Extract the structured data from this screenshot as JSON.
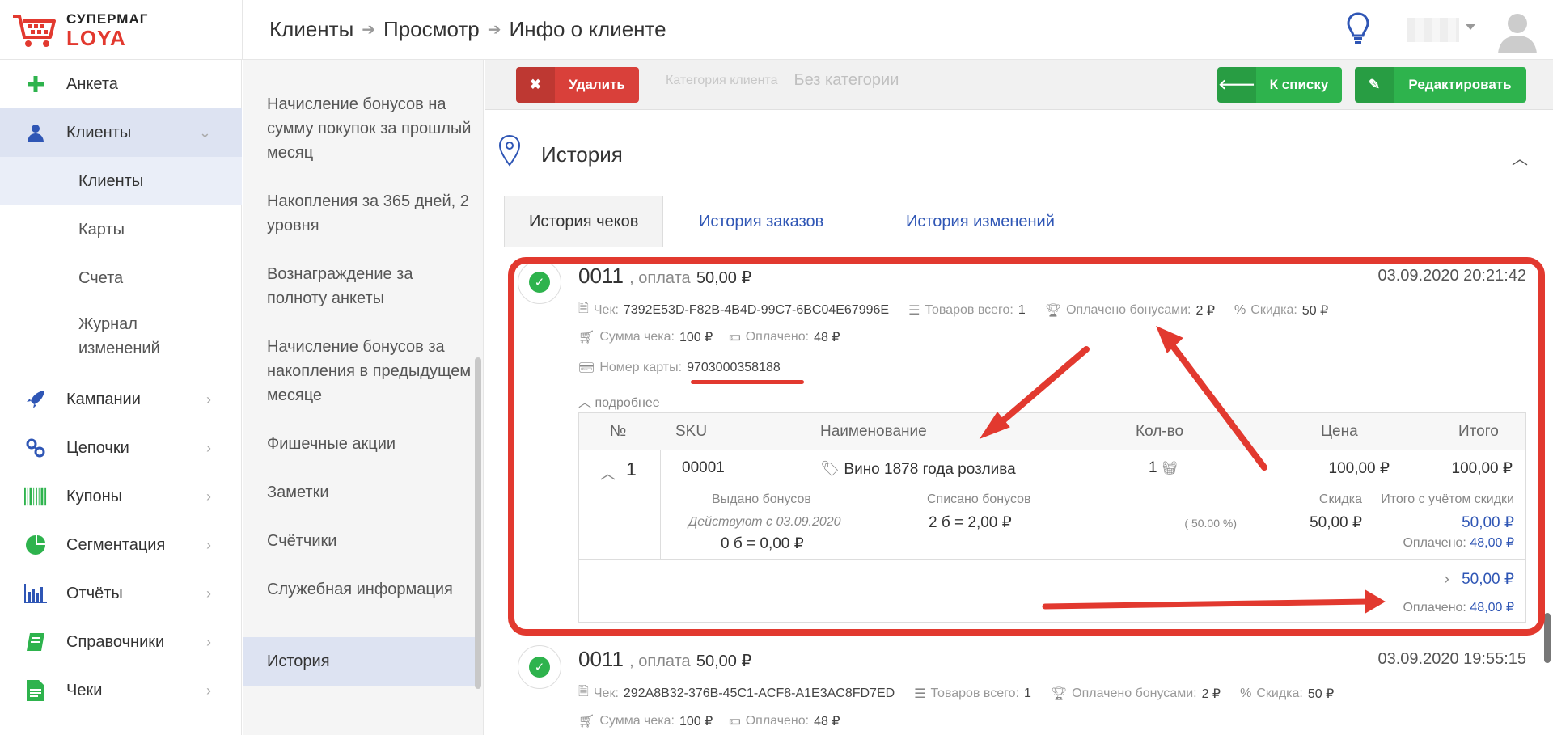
{
  "logo": {
    "top": "СУПЕРМАГ",
    "bottom": "LOYA"
  },
  "breadcrumbs": [
    "Клиенты",
    "Просмотр",
    "Инфо о клиенте"
  ],
  "sidebar": {
    "items": [
      {
        "label": "Анкета",
        "icon": "plus-icon"
      },
      {
        "label": "Клиенты",
        "icon": "user-icon"
      },
      {
        "label": "Кампании",
        "icon": "rocket-icon"
      },
      {
        "label": "Цепочки",
        "icon": "chain-icon"
      },
      {
        "label": "Купоны",
        "icon": "barcode-icon"
      },
      {
        "label": "Сегментация",
        "icon": "pie-icon"
      },
      {
        "label": "Отчёты",
        "icon": "bar-chart-icon"
      },
      {
        "label": "Справочники",
        "icon": "book-icon"
      },
      {
        "label": "Чеки",
        "icon": "document-icon"
      }
    ],
    "sub_items": [
      "Клиенты",
      "Карты",
      "Счета",
      "Журнал изменений"
    ]
  },
  "panel2": {
    "items": [
      "Начисление бонусов на сумму покупок за прошлый месяц",
      "Накопления за 365 дней, 2 уровня",
      "Вознаграждение за полноту анкеты",
      "Начисление бонусов за накопления в предыдущем месяце",
      "Фишечные акции",
      "Заметки",
      "Счётчики",
      "Служебная информация",
      "История"
    ]
  },
  "actions": {
    "delete": "Удалить",
    "category_label": "Категория клиента",
    "category_value": "Без категории",
    "to_list": "К списку",
    "edit": "Редактировать"
  },
  "history": {
    "title": "История",
    "tabs": [
      "История чеков",
      "История заказов",
      "История изменений"
    ]
  },
  "receipts": [
    {
      "number": "0011",
      "pay_label": ", оплата",
      "pay_sum": "50,00 ₽",
      "date": "03.09.2020 20:21:42",
      "check_label": "Чек:",
      "check_id": "7392E53D-F82B-4B4D-99C7-6BC04E67996E",
      "goods_label": "Товаров всего:",
      "goods": "1",
      "bonus_label": "Оплачено бонусами:",
      "bonus": "2 ₽",
      "discount_label": "Скидка:",
      "discount": "50 ₽",
      "sum_label": "Сумма чека:",
      "sum": "100 ₽",
      "paid_label": "Оплачено:",
      "paid": "48 ₽",
      "card_label": "Номер карты:",
      "card": "9703000358188",
      "more": "подробнее"
    },
    {
      "number": "0011",
      "pay_label": ", оплата",
      "pay_sum": "50,00 ₽",
      "date": "03.09.2020 19:55:15",
      "check_label": "Чек:",
      "check_id": "292A8B32-376B-45C1-ACF8-A1E3AC8FD7ED",
      "goods_label": "Товаров всего:",
      "goods": "1",
      "bonus_label": "Оплачено бонусами:",
      "bonus": "2 ₽",
      "discount_label": "Скидка:",
      "discount": "50 ₽",
      "sum_label": "Сумма чека:",
      "sum": "100 ₽",
      "paid_label": "Оплачено:",
      "paid": "48 ₽"
    }
  ],
  "table": {
    "headers": [
      "№",
      "SKU",
      "Наименование",
      "Кол-во",
      "Цена",
      "Итого"
    ],
    "row": {
      "num": "1",
      "sku": "00001",
      "name": "Вино 1878 года розлива",
      "qty": "1",
      "price": "100,00 ₽",
      "total": "100,00 ₽",
      "issued_label": "Выдано бонусов",
      "valid_from": "Действуют с 03.09.2020",
      "issued_value": "0 б = 0,00 ₽",
      "written_label": "Списано бонусов",
      "written_value": "2 б = 2,00 ₽",
      "discount_label": "Скидка",
      "discount_pct": "( 50.00 %)",
      "discount_value": "50,00 ₽",
      "total_disc_label": "Итого с учётом скидки",
      "total_disc_value": "50,00 ₽",
      "paid_label": "Оплачено:",
      "paid_value": "48,00 ₽"
    },
    "footer": {
      "total": "50,00 ₽",
      "paid_label": "Оплачено:",
      "paid_value": "48,00 ₽"
    }
  },
  "colors": {
    "accent_red": "#e2392f",
    "green": "#2eb34d",
    "link_blue": "#2f56b5"
  }
}
